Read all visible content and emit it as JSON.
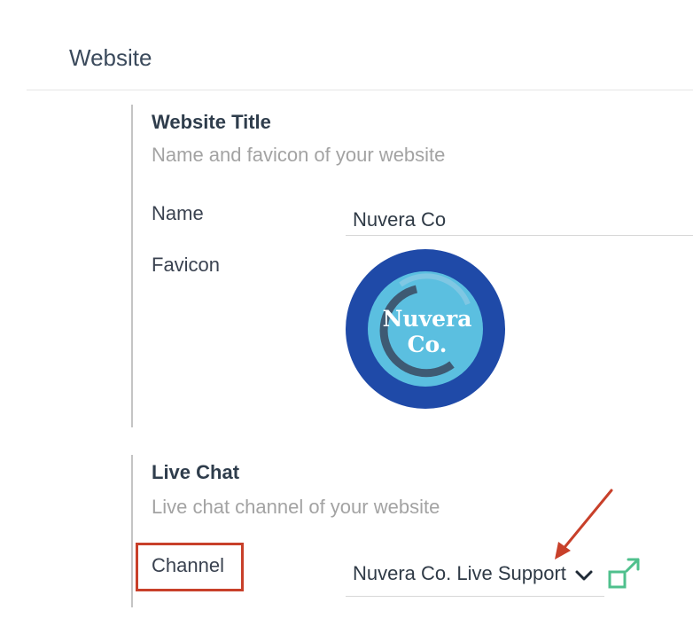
{
  "section": {
    "title": "Website"
  },
  "website_title": {
    "heading": "Website Title",
    "subtitle": "Name and favicon of your website",
    "name_label": "Name",
    "name_value": "Nuvera Co",
    "favicon_label": "Favicon",
    "favicon_text_line1": "Nuvera",
    "favicon_text_line2": "Co."
  },
  "live_chat": {
    "heading": "Live Chat",
    "subtitle": "Live chat channel of your website",
    "channel_label": "Channel",
    "channel_value": "Nuvera Co. Live Support"
  },
  "icons": {
    "dropdown": "chevron-down-icon",
    "external": "external-link-icon",
    "annotation": "red-arrow-annotation"
  },
  "colors": {
    "favicon_outer": "#1f4aa8",
    "favicon_inner": "#5bbfe0",
    "annotation_red": "#c8402a",
    "external_link_green": "#4fc08d"
  }
}
